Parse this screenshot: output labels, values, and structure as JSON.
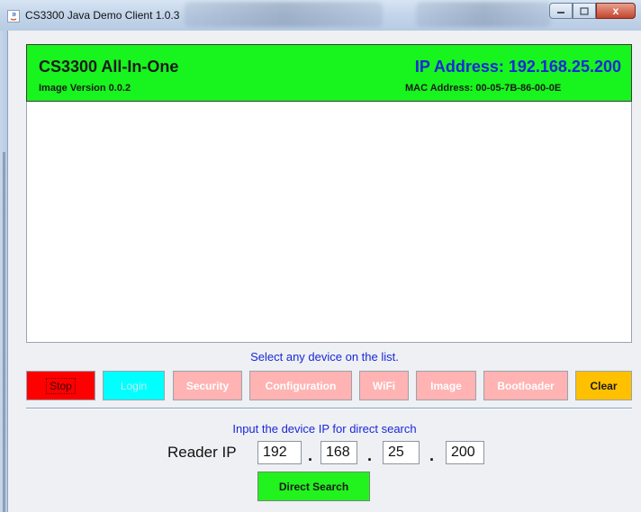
{
  "window": {
    "title": "CS3300 Java Demo Client 1.0.3",
    "controls": {
      "minimize_icon": "minimize-icon",
      "maximize_icon": "maximize-icon",
      "close_icon": "close-icon",
      "close_symbol": "x"
    }
  },
  "device_header": {
    "name": "CS3300 All-In-One",
    "image_version": "Image Version 0.0.2",
    "ip_address": "IP Address: 192.168.25.200",
    "mac_address": "MAC Address: 00-05-7B-86-00-0E",
    "background_color": "#18f41d",
    "ip_color": "#1a28d8"
  },
  "device_list": {
    "items": []
  },
  "hint_text": "Select any device on the list.",
  "buttons": {
    "stop": "Stop",
    "login": "Login",
    "security": "Security",
    "configuration": "Configuration",
    "wifi": "WiFi",
    "image": "Image",
    "bootloader": "Bootloader",
    "clear": "Clear"
  },
  "direct_search": {
    "hint": "Input the device IP for direct search",
    "label": "Reader IP",
    "ip_octets": [
      "192",
      "168",
      "25",
      "200"
    ],
    "separator": ".",
    "button_label": "Direct Search"
  }
}
